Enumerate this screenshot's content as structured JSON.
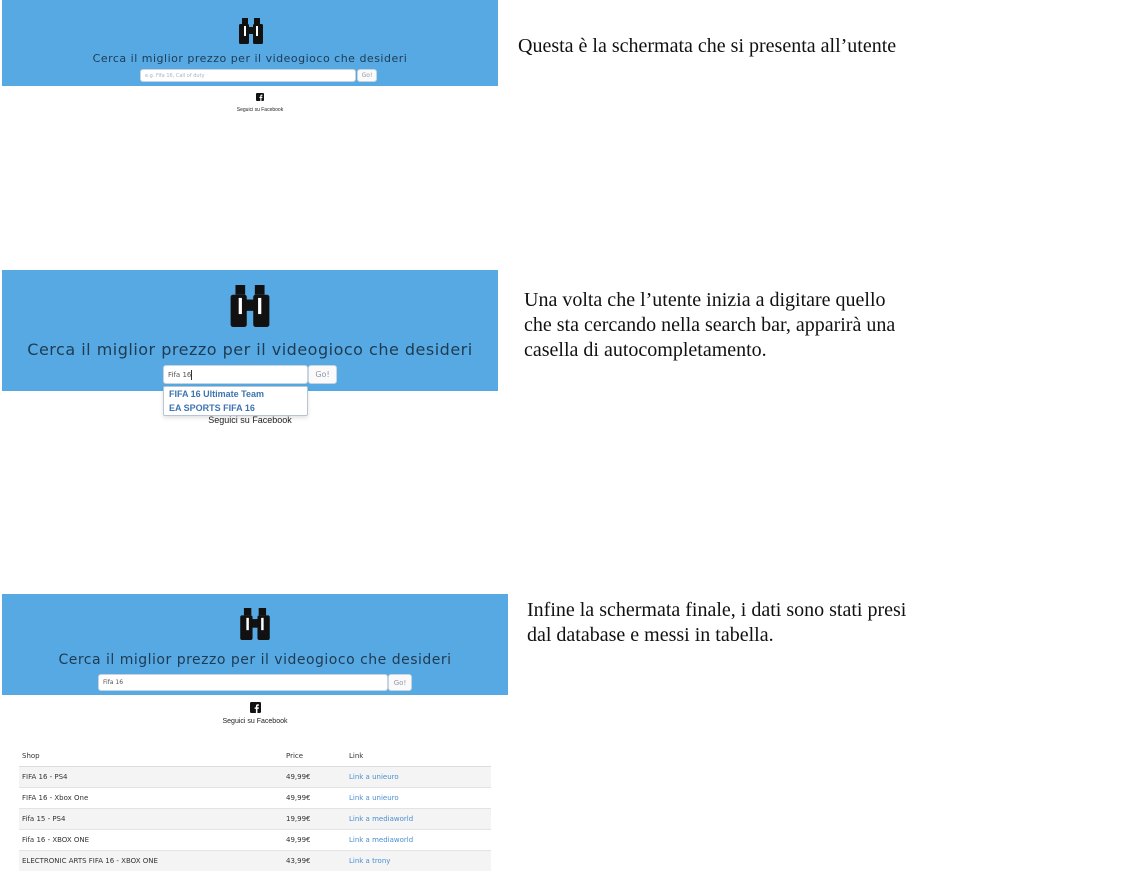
{
  "colors": {
    "hero_bg": "#56a9e3",
    "tagline": "#1f3b52",
    "link": "#4b8fd0",
    "autocomplete_text": "#3d74b0"
  },
  "tagline": "Cerca il miglior prezzo per il videogioco che desideri",
  "go_label": "Go!",
  "facebook": {
    "icon": "facebook-icon",
    "label": "Seguici su Facebook"
  },
  "screen1": {
    "search_placeholder": "e.g. Fifa 16, Call of duty",
    "caption": "Questa è la schermata che si presenta all’utente"
  },
  "screen2": {
    "search_value": "Fifa 16",
    "autocomplete": [
      "FIFA 16 Ultimate Team",
      "EA SPORTS FIFA 16"
    ],
    "caption_lines": [
      "Una volta che l’utente inizia a digitare quello",
      "che sta cercando nella search bar, apparirà una",
      "casella di autocompletamento."
    ]
  },
  "screen3": {
    "search_value": "Fifa 16",
    "caption_lines": [
      "Infine la schermata finale, i dati sono stati presi",
      "dal database e messi in tabella."
    ],
    "table": {
      "headers": [
        "Shop",
        "Price",
        "Link"
      ],
      "rows": [
        [
          "FIFA 16 - PS4",
          "49,99€",
          "Link a unieuro"
        ],
        [
          "FIFA 16 - Xbox One",
          "49,99€",
          "Link a unieuro"
        ],
        [
          "Fifa 15 - PS4",
          "19,99€",
          "Link a mediaworld"
        ],
        [
          "Fifa 16 - XBOX ONE",
          "49,99€",
          "Link a mediaworld"
        ],
        [
          "ELECTRONIC ARTS FIFA 16 - XBOX ONE",
          "43,99€",
          "Link a trony"
        ]
      ]
    }
  }
}
